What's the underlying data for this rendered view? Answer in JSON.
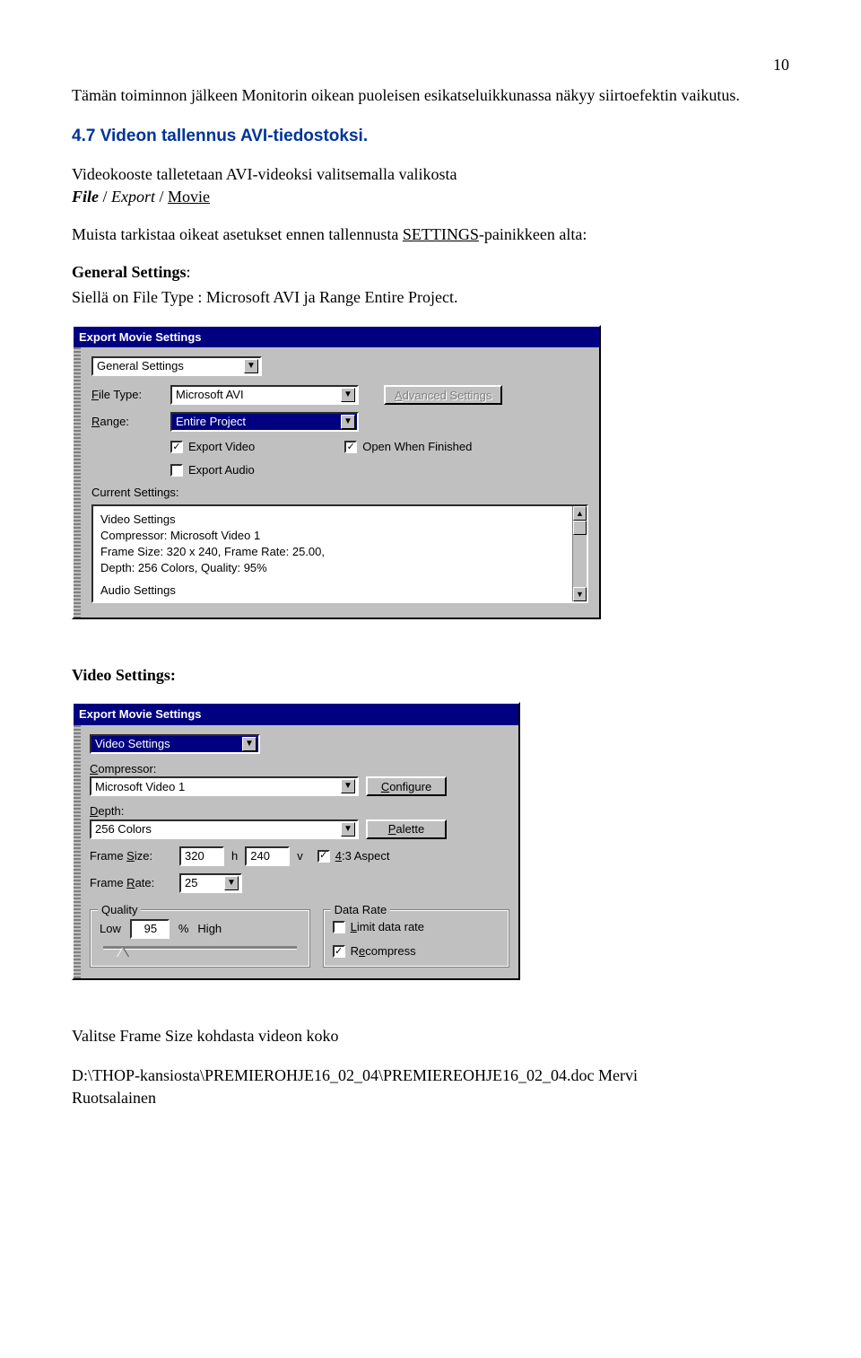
{
  "page_number": "10",
  "para1": "Tämän toiminnon jälkeen Monitorin oikean puoleisen esikatseluikkunassa näkyy siirtoefektin vaikutus.",
  "heading": "4.7 Videon tallennus AVI-tiedostoksi.",
  "para2_a": "Videokooste talletetaan AVI-videoksi valitsemalla  valikosta",
  "para2_b_file": "File",
  "para2_b_sep1": " / ",
  "para2_b_export": "Export",
  "para2_b_sep2": " / ",
  "para2_b_movie": "Movie",
  "para3_a": "Muista tarkistaa oikeat asetukset ennen tallennusta  ",
  "para3_b": "SETTINGS",
  "para3_c": "-painikkeen alta:",
  "para4_a": "General Settings",
  "para4_b": ":",
  "para5": "Siellä on File Type : Microsoft AVI ja Range Entire Project.",
  "dlg1": {
    "title": "Export Movie Settings",
    "section_value": "General Settings",
    "file_type_label": "File Type:",
    "file_type_value": "Microsoft AVI",
    "adv_button": "Advanced Settings",
    "range_label": "Range:",
    "range_value": "Entire Project",
    "export_video": "Export Video",
    "open_when_finished": "Open When Finished",
    "export_audio": "Export Audio",
    "current_settings": "Current Settings:",
    "cs_line1": "Video Settings",
    "cs_line2": "Compressor: Microsoft Video 1",
    "cs_line3": "Frame Size: 320 x 240, Frame Rate: 25.00,",
    "cs_line4": "Depth: 256 Colors, Quality: 95%",
    "cs_line5": "Audio Settings"
  },
  "video_settings_heading": "Video Settings:",
  "dlg2": {
    "title": "Export Movie Settings",
    "section_value": "Video Settings",
    "compressor_label": "Compressor:",
    "compressor_value": "Microsoft Video 1",
    "configure_btn": "Configure",
    "depth_label": "Depth:",
    "depth_value": "256 Colors",
    "palette_btn": "Palette",
    "frame_size_label": "Frame Size:",
    "frame_w": "320",
    "h": "h",
    "frame_h": "240",
    "v": "v",
    "aspect": "4:3 Aspect",
    "frame_rate_label": "Frame Rate:",
    "frame_rate_value": "25",
    "quality_legend": "Quality",
    "low": "Low",
    "high": "High",
    "quality_val": "95",
    "pct": "%",
    "data_rate_legend": "Data Rate",
    "limit_data_rate": "Limit data rate",
    "recompress": "Recompress"
  },
  "after_dlg2": "Valitse Frame Size kohdasta videon koko",
  "footer_a": "D:\\THOP-kansiosta\\PREMIEROHJE16_02_04\\PREMIEREOHJE16_02_04.doc Mervi",
  "footer_b": "Ruotsalainen"
}
